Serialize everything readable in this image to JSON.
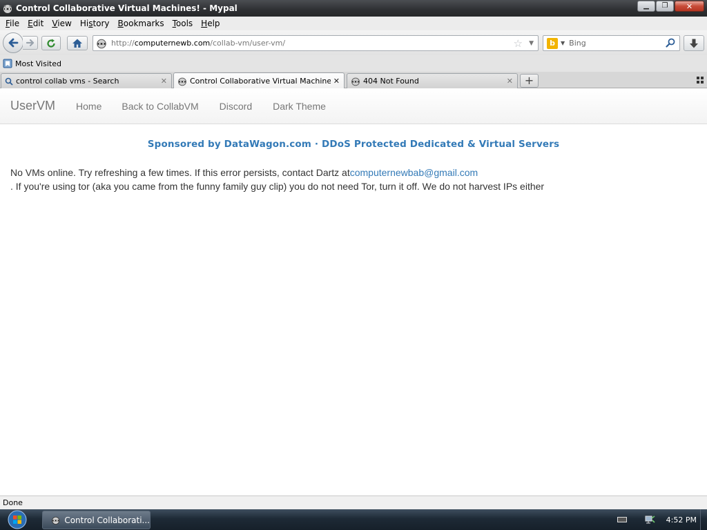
{
  "window": {
    "title": "Control Collaborative Virtual Machines! - Mypal",
    "minimize_glyph": "▁",
    "maximize_glyph": "❐",
    "close_glyph": "✕"
  },
  "menu": {
    "items": [
      {
        "accesskey": "F",
        "rest": "ile"
      },
      {
        "accesskey": "E",
        "rest": "dit"
      },
      {
        "accesskey": "V",
        "rest": "iew"
      },
      {
        "accesskey": "",
        "pre": "Hi",
        "accesskey2": "s",
        "rest": "tory"
      },
      {
        "accesskey": "B",
        "rest": "ookmarks"
      },
      {
        "accesskey": "T",
        "rest": "ools"
      },
      {
        "accesskey": "H",
        "rest": "elp"
      }
    ]
  },
  "nav": {
    "url_proto": "http://",
    "url_host": "computernewb.com",
    "url_path": "/collab-vm/user-vm/",
    "search_placeholder": "Bing",
    "search_engine_letter": "b",
    "star_glyph": "☆",
    "dropdown_glyph": "▼"
  },
  "bookmarks": {
    "items": [
      {
        "label": "Most Visited",
        "icon": "bookmarks-folder-icon"
      }
    ]
  },
  "tabs": [
    {
      "label": "control collab vms - Search",
      "icon": "search-icon",
      "active": false
    },
    {
      "label": "Control Collaborative Virtual Machines!",
      "icon": "raccoon-icon",
      "active": true
    },
    {
      "label": "404 Not Found",
      "icon": "raccoon-icon",
      "active": false
    }
  ],
  "tab_close_glyph": "✕",
  "new_tab_glyph": "+",
  "site": {
    "brand": "UserVM",
    "links": [
      "Home",
      "Back to CollabVM",
      "Discord",
      "Dark Theme"
    ],
    "sponsor": "Sponsored by DataWagon.com · DDoS Protected Dedicated & Virtual Servers",
    "message_before_link": "No VMs online. Try refreshing a few times. If this error persists, contact Dartz at",
    "message_link": "computernewbab@gmail.com",
    "message_after_link": ". If you're using tor (aka you came from the funny family guy clip) you do not need Tor, turn it off. We do not harvest IPs either"
  },
  "status": {
    "text": "Done"
  },
  "taskbar": {
    "task_label": "Control Collaborati...",
    "clock": "4:52 PM"
  },
  "colors": {
    "link": "#337ab7",
    "nav_text": "#777777",
    "titlebar": "#2e3033",
    "taskbar": "#1e2a36"
  }
}
